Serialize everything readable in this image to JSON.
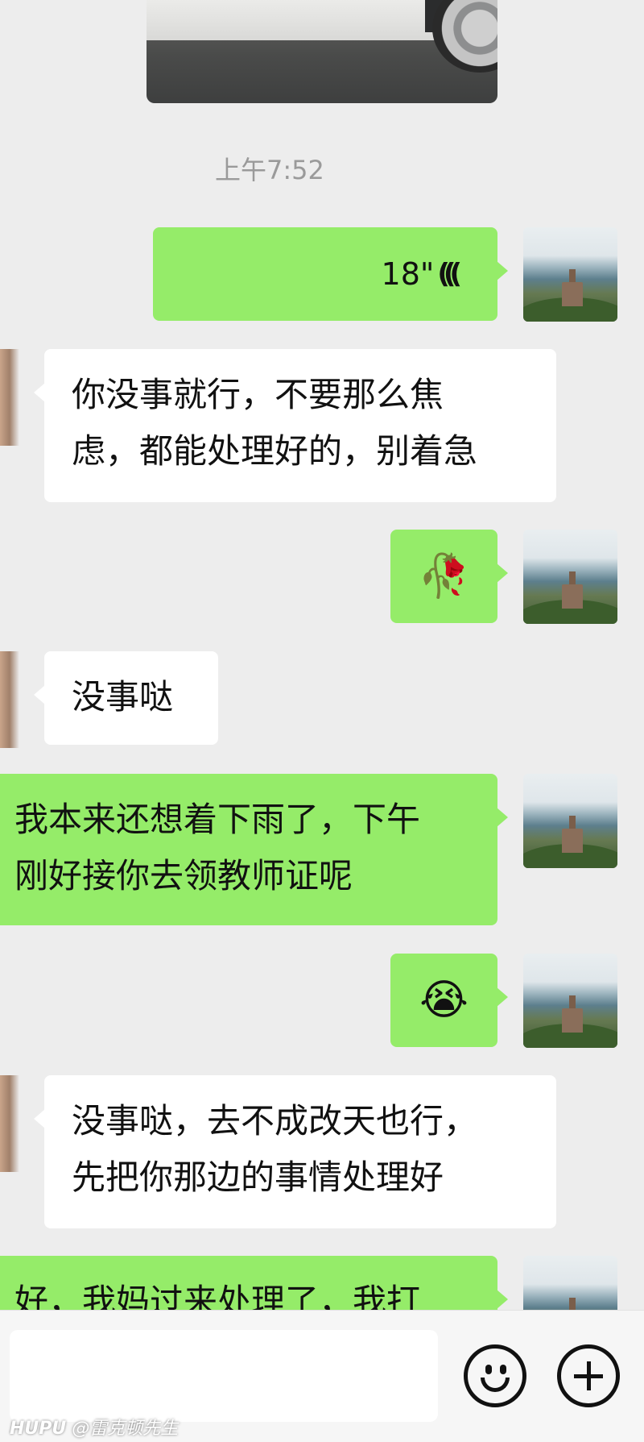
{
  "chat": {
    "timestamp": "上午7:52",
    "voice_message": {
      "duration": "18\"",
      "icon": "voice-waves-icon"
    },
    "messages": [
      {
        "side": "received",
        "text_line1": "你没事就行，不要那么焦",
        "text_line2": "虑，都能处理好的，别着急"
      },
      {
        "side": "sent",
        "emoji": "🥀"
      },
      {
        "side": "received",
        "text_line1": "没事哒"
      },
      {
        "side": "sent",
        "text_line1": "我本来还想着下雨了，下午",
        "text_line2": "刚好接你去领教师证呢"
      },
      {
        "side": "sent",
        "emoji": "😭"
      },
      {
        "side": "received",
        "text_line1": "没事哒，去不成改天也行，",
        "text_line2": "先把你那边的事情处理好"
      },
      {
        "side": "sent",
        "text_line1": "好，我妈过来处理了，我打"
      }
    ]
  },
  "input_bar": {
    "emoji_icon": "smiley-icon",
    "plus_icon": "plus-icon"
  },
  "watermark": {
    "brand": "HUPU",
    "handle": "@雷克顿先生"
  }
}
